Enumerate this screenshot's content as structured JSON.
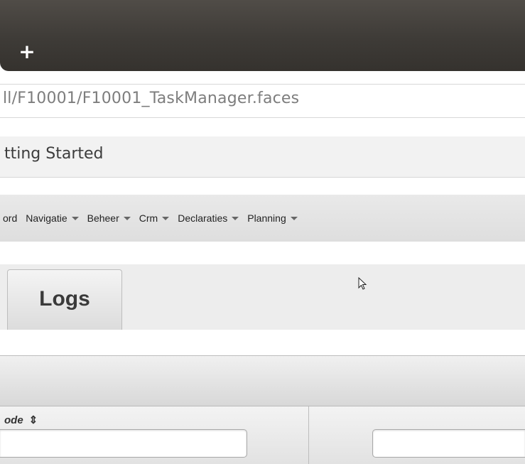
{
  "browser": {
    "new_tab_symbol": "+",
    "url": "ll/F10001/F10001_TaskManager.faces",
    "bookmark": "tting Started"
  },
  "menu": {
    "items": [
      {
        "label": "ord",
        "has_caret": false
      },
      {
        "label": "Navigatie",
        "has_caret": true
      },
      {
        "label": "Beheer",
        "has_caret": true
      },
      {
        "label": "Crm",
        "has_caret": true
      },
      {
        "label": "Declaraties",
        "has_caret": true
      },
      {
        "label": "Planning",
        "has_caret": true
      }
    ]
  },
  "tabs": {
    "active": "Logs"
  },
  "table": {
    "columns": [
      {
        "title": "ode",
        "sort_icon": "⇕"
      }
    ]
  },
  "colors": {
    "tabstrip": "#3e3b37",
    "menubar": "#e3e3e3",
    "url_text": "#7d7d7d"
  }
}
